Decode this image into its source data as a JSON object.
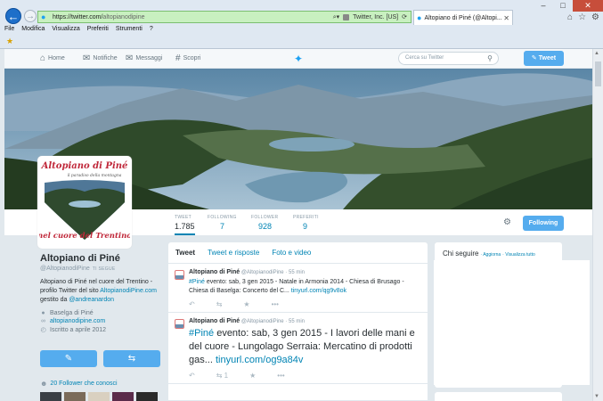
{
  "browser": {
    "url_host": "https://twitter.com/",
    "url_path": "altopianodipine",
    "cert": "Twitter, Inc. [US]",
    "tab_title": "Altopiano di Piné (@Altopi...",
    "menu": [
      "File",
      "Modifica",
      "Visualizza",
      "Preferiti",
      "Strumenti",
      "?"
    ]
  },
  "twitter_nav": {
    "home": "Home",
    "notifications": "Notifiche",
    "messages": "Messaggi",
    "discover": "Scopri",
    "search_placeholder": "Cerca su Twitter",
    "tweet_button": "Tweet"
  },
  "stats": [
    {
      "label": "TWEET",
      "value": "1.785"
    },
    {
      "label": "FOLLOWING",
      "value": "7"
    },
    {
      "label": "FOLLOWER",
      "value": "928"
    },
    {
      "label": "PREFERITI",
      "value": "9"
    }
  ],
  "follow_button": "Following",
  "avatar": {
    "title": "Altopiano di Piné",
    "subtitle": "il paradiso della montagna",
    "tagline": "nel cuore del Trentino"
  },
  "profile": {
    "name": "Altopiano di Piné",
    "handle": "@AltopianodiPine",
    "follows_you": "TI SEGUE",
    "bio_1": "Altopiano di Piné nel cuore del Trentino - profilo Twitter del sito ",
    "bio_link": "AltopianodiPine.com",
    "bio_2": " gestito da ",
    "bio_mention": "@andreanardon",
    "location": "Baselga di Piné",
    "website": "altopianodipine.com",
    "joined": "Iscritto a aprile 2012",
    "followers_known": "20 Follower che conosci"
  },
  "timeline": {
    "tabs": [
      "Tweet",
      "Tweet e risposte",
      "Foto e video"
    ],
    "tweets": [
      {
        "name": "Altopiano di Piné",
        "handle": "@AltopianodiPine",
        "time": "55 min",
        "hashtag": "#Piné",
        "text": " evento: sab, 3 gen 2015 - Natale in Armonia 2014 - Chiesa di Brusago - Chiesa di Baselga: Concerto del C... ",
        "link": "tinyurl.com/qg9v8ok",
        "retweets": ""
      },
      {
        "name": "Altopiano di Piné",
        "handle": "@AltopianodiPine",
        "time": "55 min",
        "hashtag": "#Piné",
        "text": " evento: sab, 3 gen 2015 - I lavori delle mani e del cuore - Lungolago Serraia: Mercatino di prodotti gas... ",
        "link": "tinyurl.com/og9a84v",
        "retweets": "1"
      }
    ]
  },
  "who_to_follow": {
    "title": "Chi seguire",
    "refresh": "Aggiorna",
    "view_all": "Visualizza tutto"
  }
}
